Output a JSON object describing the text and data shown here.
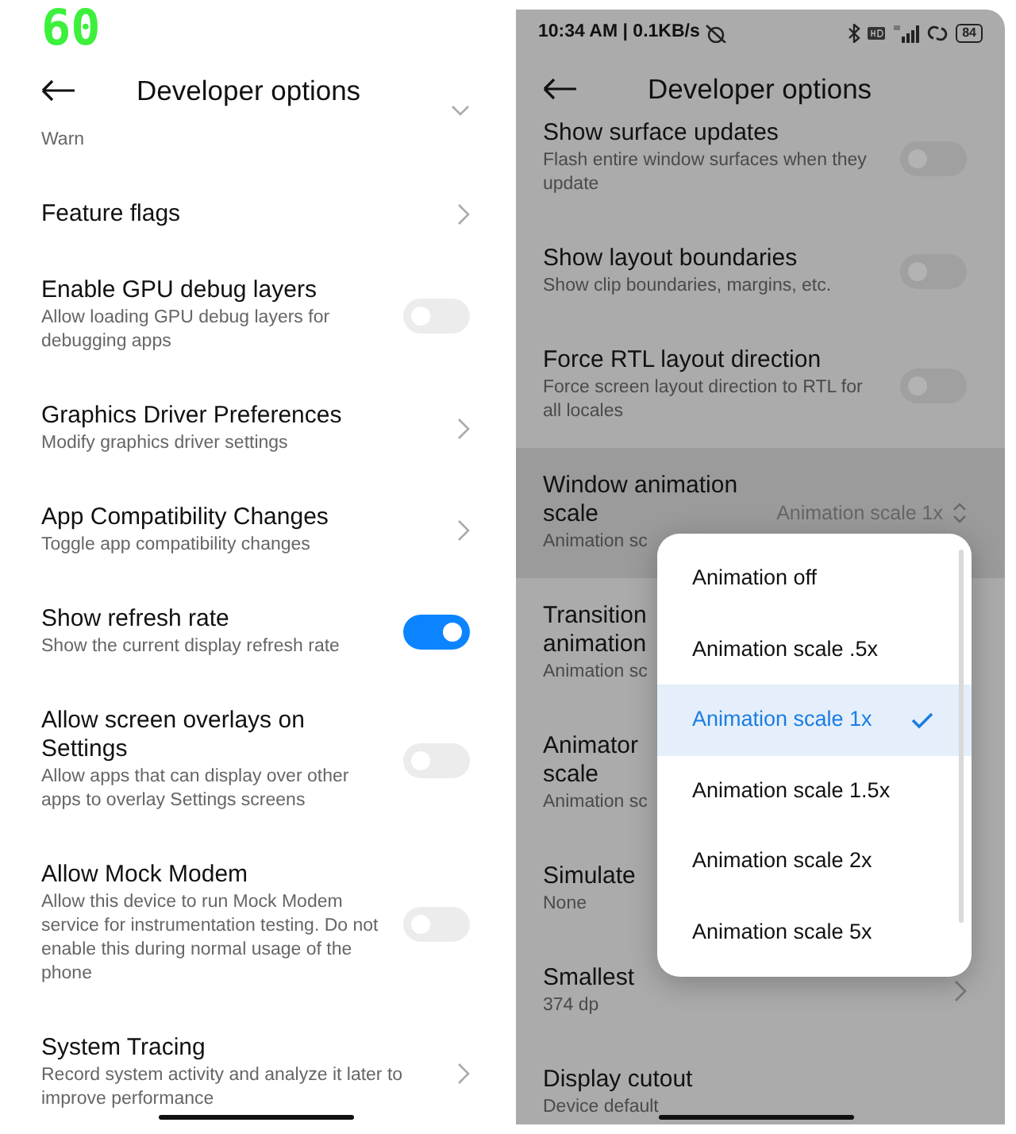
{
  "left_screen": {
    "fps_overlay": "60",
    "header": {
      "title": "Developer options"
    },
    "items": [
      {
        "kind": "value",
        "subtitle": "Warn"
      },
      {
        "kind": "link",
        "title": "Feature flags"
      },
      {
        "kind": "toggle",
        "title": "Enable GPU debug layers",
        "subtitle": "Allow loading GPU debug layers for debugging apps",
        "on": false
      },
      {
        "kind": "link",
        "title": "Graphics Driver Preferences",
        "subtitle": "Modify graphics driver settings"
      },
      {
        "kind": "link",
        "title": "App Compatibility Changes",
        "subtitle": "Toggle app compatibility changes"
      },
      {
        "kind": "toggle",
        "title": "Show refresh rate",
        "subtitle": "Show the current display refresh rate",
        "on": true
      },
      {
        "kind": "toggle",
        "title": "Allow screen overlays on Settings",
        "subtitle": "Allow apps that can display over other apps to overlay Settings screens",
        "on": false
      },
      {
        "kind": "toggle",
        "title": "Allow Mock Modem",
        "subtitle": "Allow this device to run Mock Modem service for instrumentation testing. Do not enable this during normal usage of the phone",
        "on": false
      },
      {
        "kind": "link",
        "title": "System Tracing",
        "subtitle": "Record system activity and analyze it later to improve performance"
      }
    ]
  },
  "right_screen": {
    "status_bar": {
      "time": "10:34 AM | 0.1KB/s",
      "battery": "84"
    },
    "header": {
      "title": "Developer options"
    },
    "items": [
      {
        "kind": "toggle",
        "title": "Show surface updates",
        "subtitle": "Flash entire window surfaces when they update",
        "on": false
      },
      {
        "kind": "toggle",
        "title": "Show layout boundaries",
        "subtitle": "Show clip boundaries, margins, etc.",
        "on": false
      },
      {
        "kind": "toggle",
        "title": "Force RTL layout direction",
        "subtitle": "Force screen layout direction to RTL for all locales",
        "on": false
      },
      {
        "kind": "select",
        "title_lines": [
          "Window animation",
          "scale"
        ],
        "subtitle": "Animation sc",
        "value": "Animation scale 1x",
        "highlighted": true
      },
      {
        "kind": "text",
        "title_lines": [
          "Transition",
          "animation"
        ],
        "subtitle": "Animation sc"
      },
      {
        "kind": "text",
        "title_lines": [
          "Animator",
          "scale"
        ],
        "subtitle": "Animation sc"
      },
      {
        "kind": "text",
        "title_lines": [
          "Simulate"
        ],
        "subtitle": "None"
      },
      {
        "kind": "link",
        "title_lines": [
          "Smallest"
        ],
        "subtitle": "374 dp"
      },
      {
        "kind": "text",
        "title_lines": [
          "Display cutout"
        ],
        "subtitle": "Device default"
      }
    ],
    "dropdown": {
      "options": [
        {
          "label": "Animation off",
          "selected": false
        },
        {
          "label": "Animation scale .5x",
          "selected": false
        },
        {
          "label": "Animation scale 1x",
          "selected": true
        },
        {
          "label": "Animation scale 1.5x",
          "selected": false
        },
        {
          "label": "Animation scale 2x",
          "selected": false
        },
        {
          "label": "Animation scale 5x",
          "selected": false
        }
      ]
    }
  }
}
